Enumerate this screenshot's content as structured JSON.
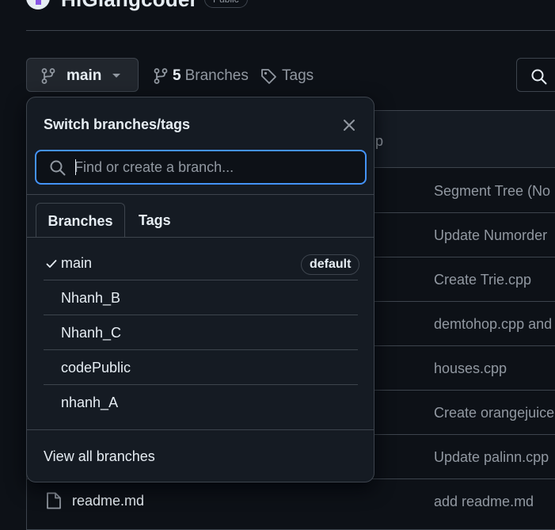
{
  "repo": {
    "name": "HiGiangcoder",
    "visibility": "Public"
  },
  "branch_bar": {
    "current_branch": "main",
    "branch_count": "5",
    "branches_label": "Branches",
    "tags_label": "Tags"
  },
  "file_table": {
    "header_fragment": "p",
    "commit_messages": [
      "Segment Tree (No",
      "Update Numorder",
      "Create Trie.cpp",
      "demtohop.cpp and",
      "houses.cpp",
      "Create orangejuice",
      "Update palinn.cpp",
      "add readme.md"
    ],
    "visible_file": "readme.md"
  },
  "dropdown": {
    "title": "Switch branches/tags",
    "filter_placeholder": "Find or create a branch...",
    "tabs": [
      "Branches",
      "Tags"
    ],
    "active_tab": "Branches",
    "branches": [
      {
        "name": "main",
        "selected": true,
        "badge": "default"
      },
      {
        "name": "Nhanh_B",
        "selected": false
      },
      {
        "name": "Nhanh_C",
        "selected": false
      },
      {
        "name": "codePublic",
        "selected": false
      },
      {
        "name": "nhanh_A",
        "selected": false
      }
    ],
    "footer_link": "View all branches"
  },
  "colors": {
    "background": "#0d1117",
    "panel": "#151b23",
    "border": "#3d444d",
    "focus": "#4493f8",
    "muted_text": "#9198a1",
    "text": "#e6edf3"
  }
}
